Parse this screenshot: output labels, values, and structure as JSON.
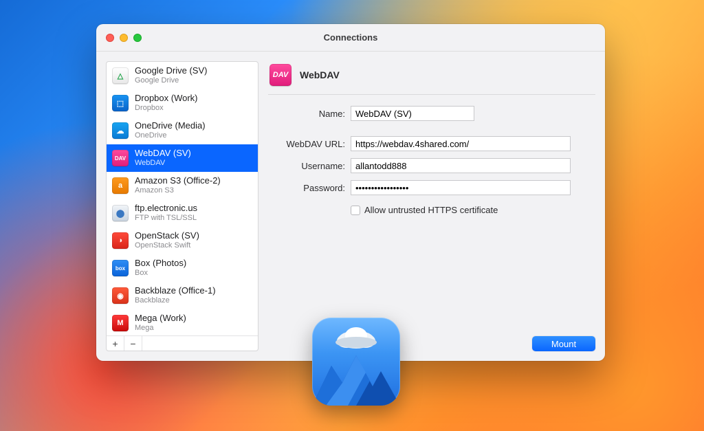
{
  "window": {
    "title": "Connections"
  },
  "sidebar": {
    "items": [
      {
        "label": "Google Drive (SV)",
        "sub": "Google Drive",
        "color": "linear-gradient(#ffffff,#e8e8e8)",
        "glyph": "△",
        "glyphColor": "#21a54a"
      },
      {
        "label": "Dropbox (Work)",
        "sub": "Dropbox",
        "color": "linear-gradient(#1893f2,#0a63c9)",
        "glyph": "⬚",
        "glyphColor": "#fff"
      },
      {
        "label": "OneDrive (Media)",
        "sub": "OneDrive",
        "color": "linear-gradient(#18a4f2,#0a7ad4)",
        "glyph": "☁",
        "glyphColor": "#fff"
      },
      {
        "label": "WebDAV (SV)",
        "sub": "WebDAV",
        "color": "linear-gradient(#ff4a9d,#e11d7b)",
        "glyph": "DAV",
        "glyphColor": "#fff",
        "selected": true
      },
      {
        "label": "Amazon S3 (Office-2)",
        "sub": "Amazon S3",
        "color": "linear-gradient(#ff9a1e,#e77a00)",
        "glyph": "a",
        "glyphColor": "#fff"
      },
      {
        "label": "ftp.electronic.us",
        "sub": "FTP with TSL/SSL",
        "color": "linear-gradient(#f2f5f9,#c9d4e0)",
        "glyph": "⬤",
        "glyphColor": "#3a78c2"
      },
      {
        "label": "OpenStack (SV)",
        "sub": "OpenStack Swift",
        "color": "linear-gradient(#ff4a3a,#d9261a)",
        "glyph": "◑",
        "glyphColor": "#fff"
      },
      {
        "label": "Box (Photos)",
        "sub": "Box",
        "color": "linear-gradient(#2f8ef5,#0a63d9)",
        "glyph": "box",
        "glyphColor": "#fff"
      },
      {
        "label": "Backblaze (Office-1)",
        "sub": "Backblaze",
        "color": "linear-gradient(#ff5a3a,#d9321a)",
        "glyph": "◉",
        "glyphColor": "#fff"
      },
      {
        "label": "Mega (Work)",
        "sub": "Mega",
        "color": "linear-gradient(#ff3a3a,#c90a0a)",
        "glyph": "M",
        "glyphColor": "#fff"
      }
    ],
    "add_glyph": "+",
    "remove_glyph": "−"
  },
  "detail": {
    "header_icon_glyph": "DAV",
    "header_title": "WebDAV",
    "name_label": "Name:",
    "name_value": "WebDAV (SV)",
    "url_label": "WebDAV URL:",
    "url_value": "https://webdav.4shared.com/",
    "user_label": "Username:",
    "user_value": "allantodd888",
    "pass_label": "Password:",
    "pass_value": "•••••••••••••••••",
    "checkbox_label": "Allow untrusted HTTPS certificate",
    "mount_label": "Mount"
  }
}
